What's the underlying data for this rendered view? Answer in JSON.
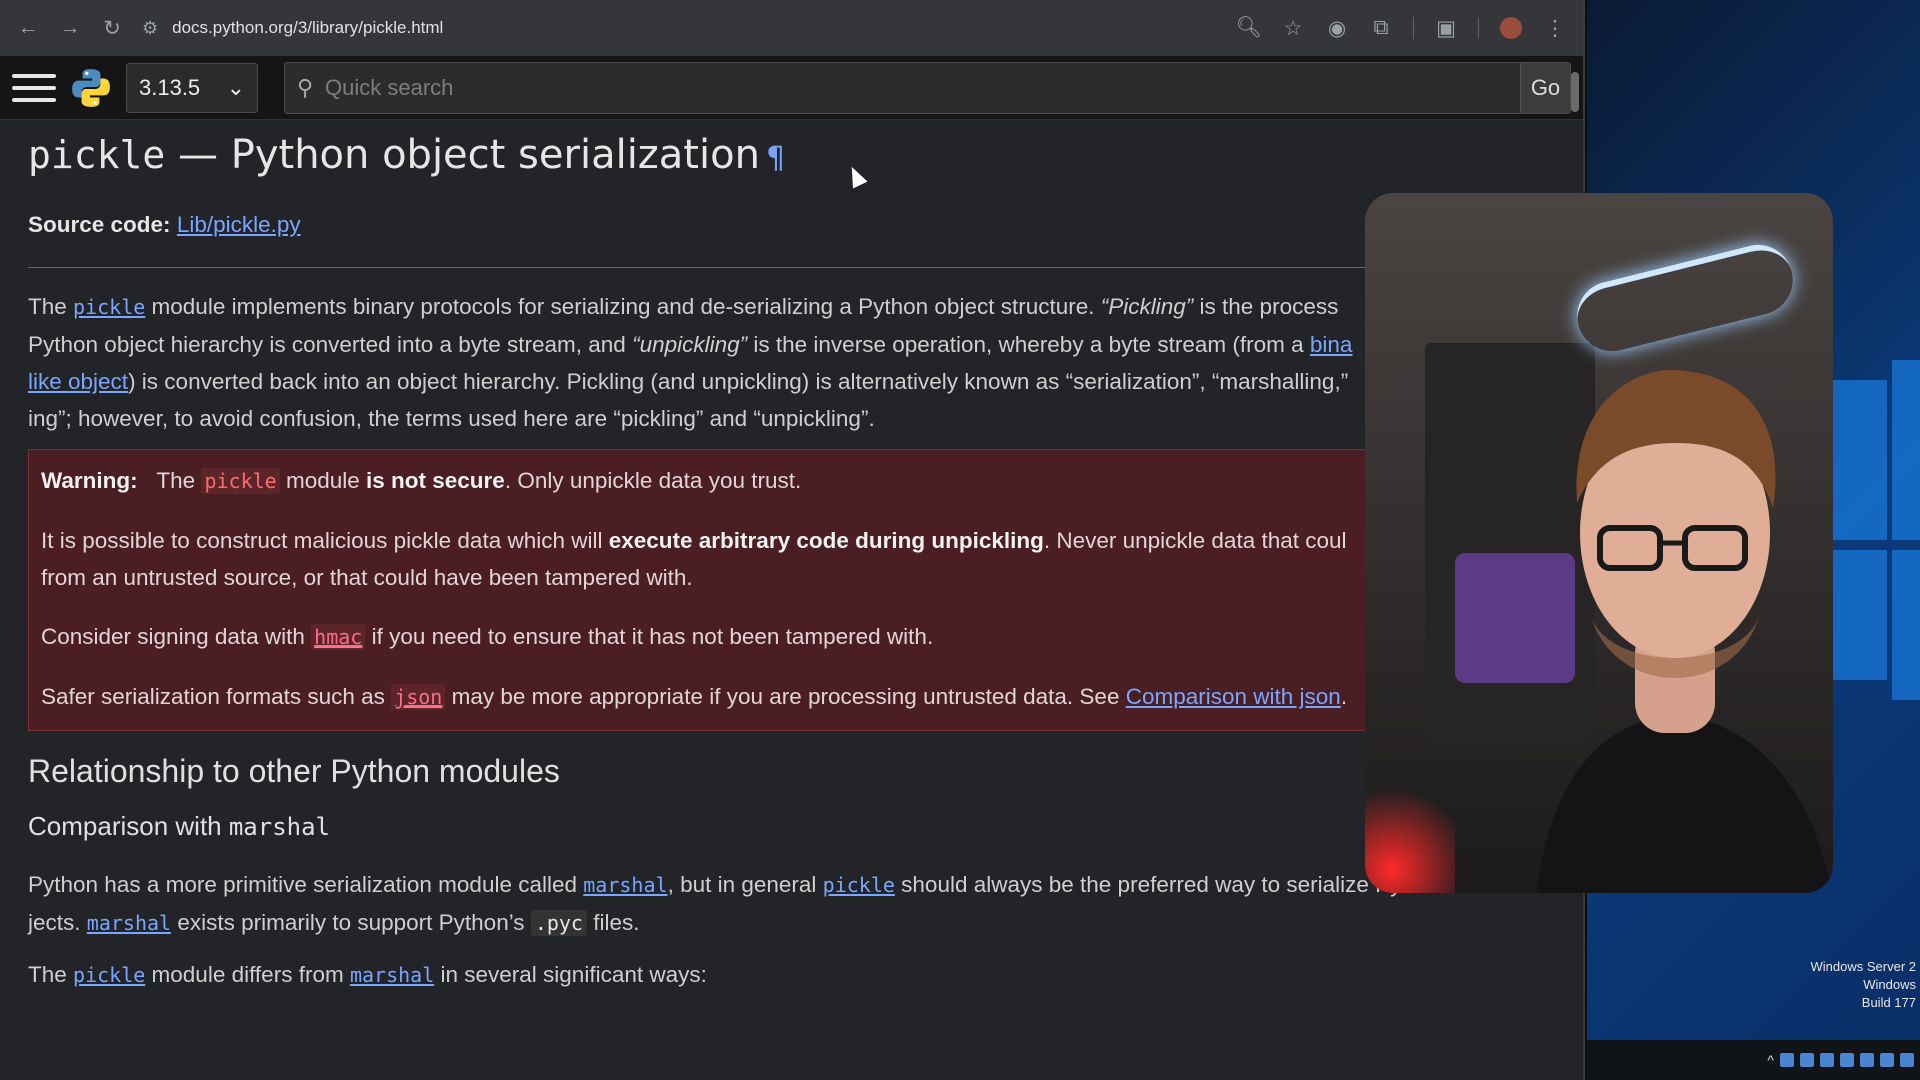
{
  "browser": {
    "url": "docs.python.org/3/library/pickle.html"
  },
  "docbar": {
    "version": "3.13.5",
    "search_placeholder": "Quick search",
    "go_label": "Go"
  },
  "doc": {
    "title_code": "pickle",
    "title_rest": " — Python object serialization",
    "pilcrow": "¶",
    "source_label": "Source code:",
    "source_link": "Lib/pickle.py",
    "intro": {
      "p1": "The ",
      "link_pickle": "pickle",
      "p2": " module implements binary protocols for serializing and de-serializing a Python object structure. ",
      "pickling_em": "“Pickling”",
      "p3": " is the process",
      "p4": "Python object hierarchy is converted into a byte stream, and ",
      "unpickling_em": "“unpickling”",
      "p5": " is the inverse operation, whereby a byte stream (from a ",
      "link_bina": "bina",
      "link_like_object": "like object",
      "p6": ") is converted back into an object hierarchy. Pickling (and unpickling) is alternatively known as “serialization”, “marshalling,”",
      "p7": "ing”; however, to avoid confusion, the terms used here are “pickling” and “unpickling”."
    },
    "warning": {
      "label": "Warning:",
      "w1a": "The ",
      "w1_code": "pickle",
      "w1b": " module ",
      "w1_bold": "is not secure",
      "w1c": ". Only unpickle data you trust.",
      "w2a": "It is possible to construct malicious pickle data which will ",
      "w2_bold": "execute arbitrary code during unpickling",
      "w2b": ". Never unpickle data that coul",
      "w2c": "from an untrusted source, or that could have been tampered with.",
      "w3a": "Consider signing data with ",
      "w3_code": "hmac",
      "w3b": " if you need to ensure that it has not been tampered with.",
      "w4a": "Safer serialization formats such as ",
      "w4_code": "json",
      "w4b": " may be more appropriate if you are processing untrusted data. See ",
      "w4_link": "Comparison with json",
      "w4c": "."
    },
    "h2": "Relationship to other Python modules",
    "h3_text": "Comparison with ",
    "h3_code": "marshal",
    "m1a": "Python has a more primitive serialization module called ",
    "m1_code1": "marshal",
    "m1b": ", but in general ",
    "m1_code2": "pickle",
    "m1c": " should always be the preferred way to serialize Python ob-",
    "m2a": "jects. ",
    "m2_code1": "marshal",
    "m2b": " exists primarily to support Python’s ",
    "m2_code2": ".pyc",
    "m2c": " files.",
    "m3a": "The ",
    "m3_code1": "pickle",
    "m3b": " module differs from ",
    "m3_code2": "marshal",
    "m3c": " in several significant ways:"
  },
  "desktop": {
    "watermark_line1": "Windows Server 2",
    "watermark_line2": "Windows",
    "watermark_line3": "Build 177"
  },
  "colors": {
    "link": "#79a6ff",
    "warning_bg": "#4a1e22",
    "code_red": "#ff6b6b"
  }
}
